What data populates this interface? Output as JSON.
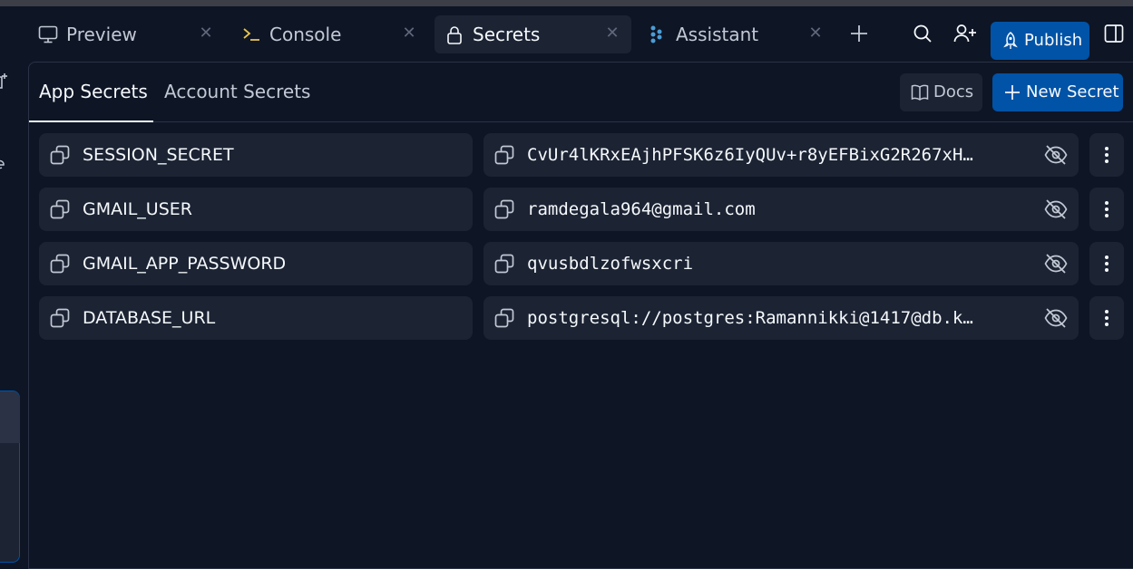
{
  "tabs": [
    {
      "label": "Preview",
      "icon": "monitor-icon",
      "active": false
    },
    {
      "label": "Console",
      "icon": "terminal-prompt-icon",
      "active": false
    },
    {
      "label": "Secrets",
      "icon": "lock-icon",
      "active": true
    },
    {
      "label": "Assistant",
      "icon": "assistant-logo-icon",
      "active": false
    }
  ],
  "toolbar": {
    "add_tab_icon": "plus-icon",
    "search_icon": "search-icon",
    "invite_icon": "add-user-icon",
    "publish_label": "Publish",
    "publish_icon": "rocket-icon",
    "layout_icon": "split-pane-icon"
  },
  "secrets_panel": {
    "subtabs": [
      "App Secrets",
      "Account Secrets"
    ],
    "docs_label": "Docs",
    "new_secret_label": "New Secret",
    "rows": [
      {
        "key": "SESSION_SECRET",
        "value": "CvUr4lKRxEAjhPFSK6z6IyQUv+r8yEFBixG2R267xH…"
      },
      {
        "key": "GMAIL_USER",
        "value": "ramdegala964@gmail.com"
      },
      {
        "key": "GMAIL_APP_PASSWORD",
        "value": "qvusbdlzofwsxcri"
      },
      {
        "key": "DATABASE_URL",
        "value": "postgresql://postgres:Ramannikki@1417@db.k…"
      }
    ]
  },
  "colors": {
    "background": "#0e1525",
    "surface": "#1c2333",
    "accent": "#0053a6",
    "text": "#f5f9fc",
    "muted": "#c2c8d4",
    "console_prompt": "#e5c453",
    "assistant_brand": "#4c9dd5"
  }
}
